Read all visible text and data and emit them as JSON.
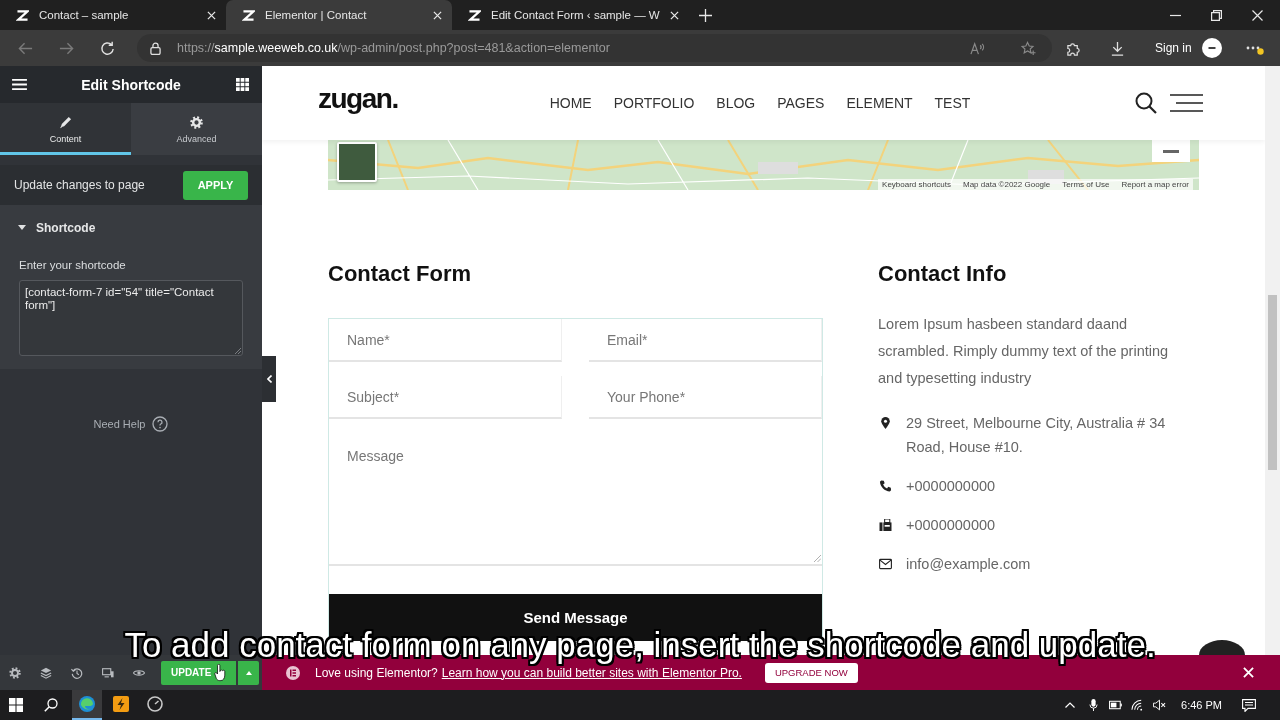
{
  "browser": {
    "tabs": [
      {
        "title": "Contact – sample",
        "selected": false
      },
      {
        "title": "Elementor | Contact",
        "selected": true
      },
      {
        "title": "Edit Contact Form ‹ sample — W",
        "selected": false
      }
    ],
    "address_bar": {
      "scheme": "https://",
      "host": "sample.weeweb.co.uk",
      "path": "/wp-admin/post.php?post=481&action=elementor"
    },
    "sign_in": "Sign in"
  },
  "editor_panel": {
    "title": "Edit Shortcode",
    "tabs": [
      {
        "label": "Content",
        "selected": true
      },
      {
        "label": "Advanced",
        "selected": false
      }
    ],
    "apply_row": {
      "label": "Update changes to page",
      "button": "APPLY"
    },
    "section": {
      "title": "Shortcode",
      "expanded": true
    },
    "field": {
      "label": "Enter your shortcode",
      "value": "[contact-form-7 id=\"54\" title=\"Contact form\"]"
    },
    "help": "Need Help"
  },
  "site": {
    "logo": "zugan.",
    "nav": [
      "HOME",
      "PORTFOLIO",
      "BLOG",
      "PAGES",
      "ELEMENT",
      "TEST"
    ],
    "map": {
      "attribution": [
        "Keyboard shortcuts",
        "Map data ©2022 Google",
        "Terms of Use",
        "Report a map error"
      ]
    },
    "contact_form": {
      "title": "Contact Form",
      "fields": [
        {
          "kind": "input",
          "placeholder": "Name*"
        },
        {
          "kind": "input",
          "placeholder": "Email*"
        },
        {
          "kind": "input",
          "placeholder": "Subject*"
        },
        {
          "kind": "input",
          "placeholder": "Your Phone*"
        },
        {
          "kind": "textarea",
          "placeholder": "Message"
        }
      ],
      "submit": "Send Message"
    },
    "contact_info": {
      "title": "Contact Info",
      "text": "Lorem Ipsum hasbeen standard daand scrambled. Rimply dummy text of the printing and typesetting industry",
      "items": [
        {
          "kind": "address",
          "text": "29 Street, Melbourne City, Australia # 34 Road, House #10."
        },
        {
          "kind": "phone",
          "text": "+0000000000"
        },
        {
          "kind": "fax",
          "text": "+0000000000"
        },
        {
          "kind": "email",
          "text": "info@example.com"
        }
      ]
    }
  },
  "caption": "To add contact form on any page, insert the shortcode and update.",
  "editor_footer": {
    "update_button": "UPDATE"
  },
  "promo_bar": {
    "question": "Love using Elementor?",
    "link": "Learn how you can build better sites with Elementor Pro.",
    "button": "UPGRADE NOW"
  },
  "taskbar": {
    "apps": [
      {
        "selected": true
      },
      {
        "selected": false
      },
      {
        "selected": false
      }
    ],
    "clock": "6:46 PM"
  }
}
